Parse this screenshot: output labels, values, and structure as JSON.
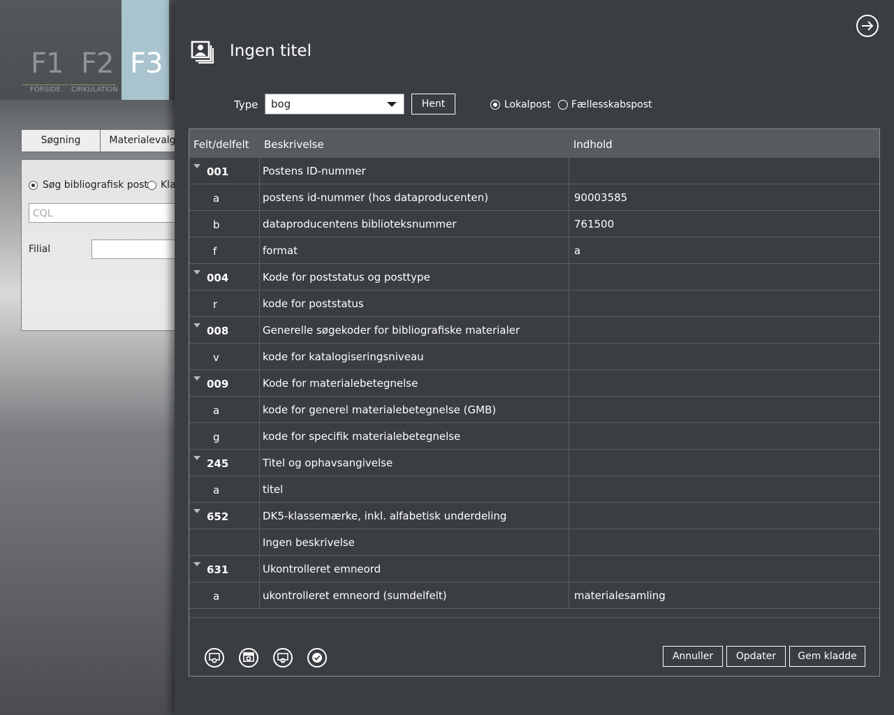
{
  "background_app": {
    "fkeys": [
      {
        "key": "F1",
        "label": "FORSIDE"
      },
      {
        "key": "F2",
        "label": "CIRKULATION"
      },
      {
        "key": "F3",
        "label": ""
      }
    ],
    "tabs": [
      "Søgning",
      "Materialevalg"
    ],
    "radio_search_label": "Søg bibliografisk post",
    "radio_other_label": "Kla",
    "cql_placeholder": "CQL",
    "filial_label": "Filial"
  },
  "dialog": {
    "title": "Ingen titel",
    "type_label": "Type",
    "type_value": "bog",
    "hent_label": "Hent",
    "radio_local": "Lokalpost",
    "radio_shared": "Fællesskabspost",
    "radio_selected": "Lokalpost",
    "columns": [
      "Felt/delfelt",
      "Beskrivelse",
      "Indhold"
    ],
    "rows": [
      {
        "kind": "field",
        "code": "001",
        "desc": "Postens ID-nummer",
        "value": ""
      },
      {
        "kind": "sub",
        "code": "a",
        "desc": "postens id-nummer (hos dataproducenten)",
        "value": "90003585"
      },
      {
        "kind": "sub",
        "code": "b",
        "desc": "dataproducentens biblioteksnummer",
        "value": "761500"
      },
      {
        "kind": "sub",
        "code": "f",
        "desc": "format",
        "value": "a"
      },
      {
        "kind": "field",
        "code": "004",
        "desc": "Kode for poststatus og posttype",
        "value": ""
      },
      {
        "kind": "sub",
        "code": "r",
        "desc": "kode for poststatus",
        "value": ""
      },
      {
        "kind": "field",
        "code": "008",
        "desc": "Generelle søgekoder for bibliografiske materialer",
        "value": ""
      },
      {
        "kind": "sub",
        "code": "v",
        "desc": "kode for katalogiseringsniveau",
        "value": ""
      },
      {
        "kind": "field",
        "code": "009",
        "desc": "Kode for materialebetegnelse",
        "value": ""
      },
      {
        "kind": "sub",
        "code": "a",
        "desc": "kode for generel materialebetegnelse (GMB)",
        "value": ""
      },
      {
        "kind": "sub",
        "code": "g",
        "desc": "kode for specifik materialebetegnelse",
        "value": ""
      },
      {
        "kind": "field",
        "code": "245",
        "desc": "Titel og ophavsangivelse",
        "value": ""
      },
      {
        "kind": "sub",
        "code": "a",
        "desc": "titel",
        "value": ""
      },
      {
        "kind": "field",
        "code": "652",
        "desc": "DK5-klassemærke, inkl. alfabetisk underdeling",
        "value": ""
      },
      {
        "kind": "sub",
        "code": "",
        "desc": "Ingen beskrivelse",
        "value": ""
      },
      {
        "kind": "field",
        "code": "631",
        "desc": "Ukontrolleret emneord",
        "value": ""
      },
      {
        "kind": "sub",
        "code": "a",
        "desc": "ukontrolleret emneord (sumdelfelt)",
        "value": "materialesamling"
      }
    ],
    "icon_buttons": [
      "add-field-icon",
      "add-subfield-icon",
      "remove-field-icon",
      "validate-icon"
    ],
    "annuller_label": "Annuller",
    "opdater_label": "Opdater",
    "gem_label": "Gem kladde"
  }
}
